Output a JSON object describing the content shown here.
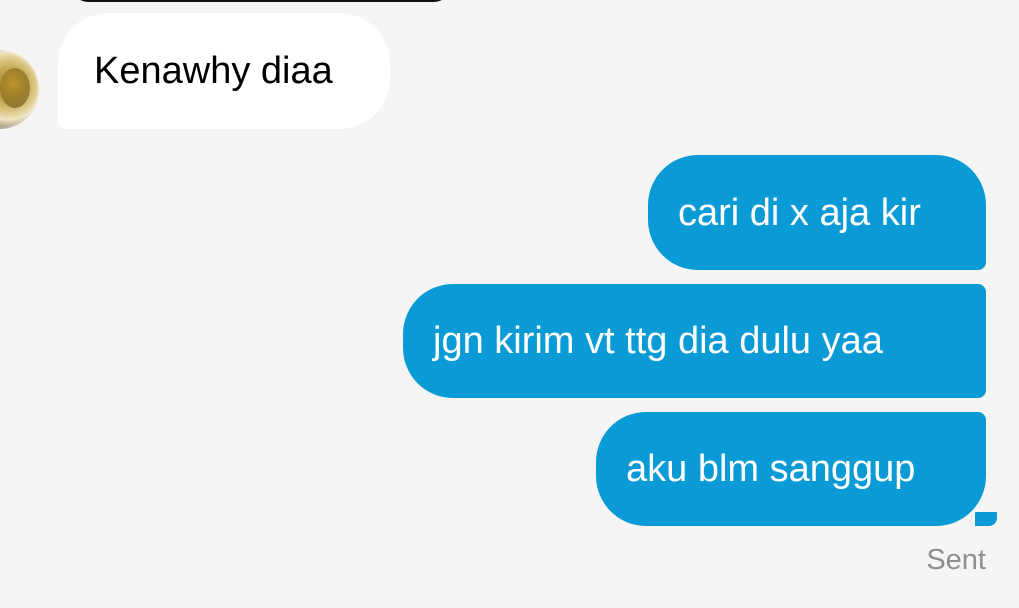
{
  "conversation": {
    "incoming_messages": [
      {
        "text": "Kenawhy diaa"
      }
    ],
    "outgoing_messages": [
      {
        "text": "cari di x aja kir"
      },
      {
        "text": "jgn kirim vt ttg dia dulu yaa"
      },
      {
        "text": "aku blm sanggup"
      }
    ],
    "delivery_status": "Sent"
  },
  "colors": {
    "background": "#f5f5f5",
    "incoming_bubble": "#ffffff",
    "outgoing_bubble": "#0a9ad6",
    "status_text": "#8e8e93"
  },
  "icons": {
    "contact_avatar": "avatar-photo"
  }
}
